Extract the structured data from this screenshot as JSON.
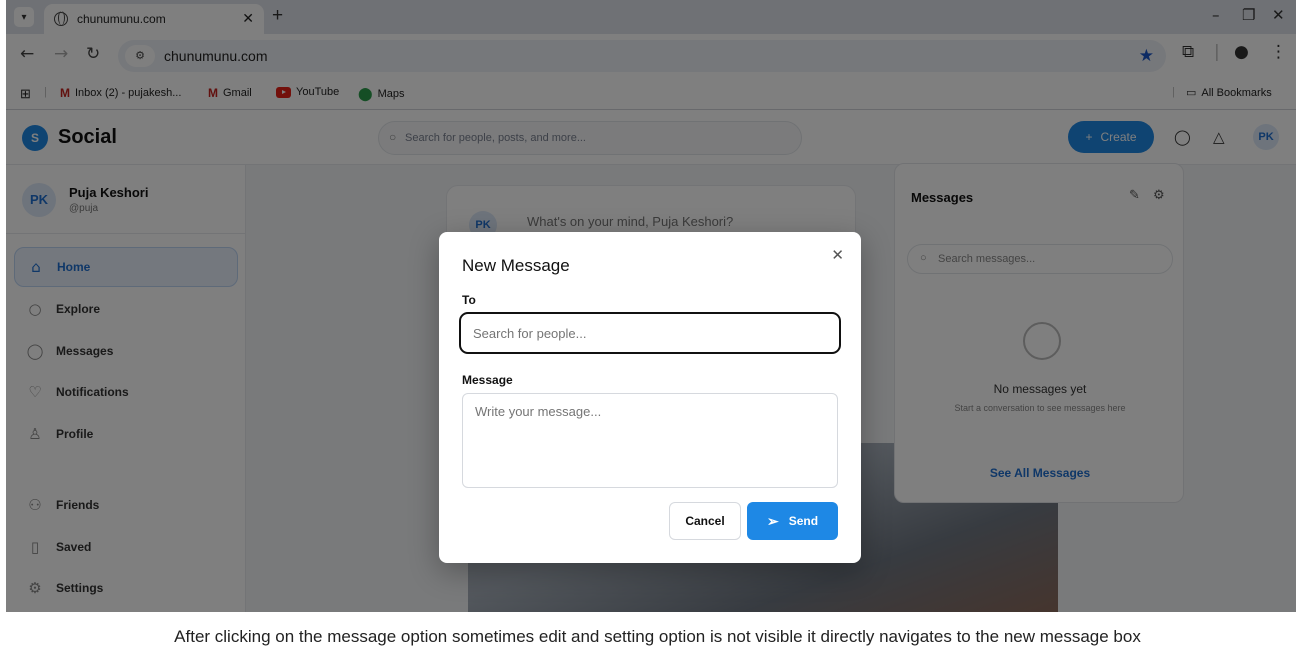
{
  "browser": {
    "tab_title": "chunumunu.com",
    "url": "chunumunu.com",
    "bookmarks": [
      "Inbox (2) - pujakesh...",
      "Gmail",
      "YouTube",
      "Maps"
    ],
    "all_bookmarks": "All Bookmarks"
  },
  "app": {
    "logo_letter": "S",
    "name": "Social",
    "search_placeholder": "Search for people, posts, and more...",
    "create_label": "Create",
    "avatar_initials": "PK"
  },
  "profile": {
    "initials": "PK",
    "name": "Puja Keshori",
    "handle": "@puja"
  },
  "sidebar": {
    "items": [
      {
        "label": "Home",
        "icon": "home-icon"
      },
      {
        "label": "Explore",
        "icon": "search-icon"
      },
      {
        "label": "Messages",
        "icon": "chat-icon"
      },
      {
        "label": "Notifications",
        "icon": "heart-icon"
      },
      {
        "label": "Profile",
        "icon": "user-icon"
      },
      {
        "label": "Friends",
        "icon": "friends-icon"
      },
      {
        "label": "Saved",
        "icon": "bookmark-icon"
      },
      {
        "label": "Settings",
        "icon": "gear-icon"
      }
    ]
  },
  "feed": {
    "composer_placeholder": "What's on your mind, Puja Keshori?",
    "composer_initials": "PK"
  },
  "messages_panel": {
    "title": "Messages",
    "search_placeholder": "Search messages...",
    "empty_title": "No messages yet",
    "empty_sub": "Start a conversation to see messages here",
    "see_all": "See All Messages"
  },
  "modal": {
    "title": "New Message",
    "to_label": "To",
    "to_placeholder": "Search for people...",
    "message_label": "Message",
    "message_placeholder": "Write your message...",
    "cancel": "Cancel",
    "send": "Send"
  },
  "caption": "After clicking on the message option sometimes edit and setting option is not visible it directly navigates to the new message box",
  "colors": {
    "accent": "#1e88e5",
    "overlay": "rgba(0,0,0,0.5)"
  }
}
